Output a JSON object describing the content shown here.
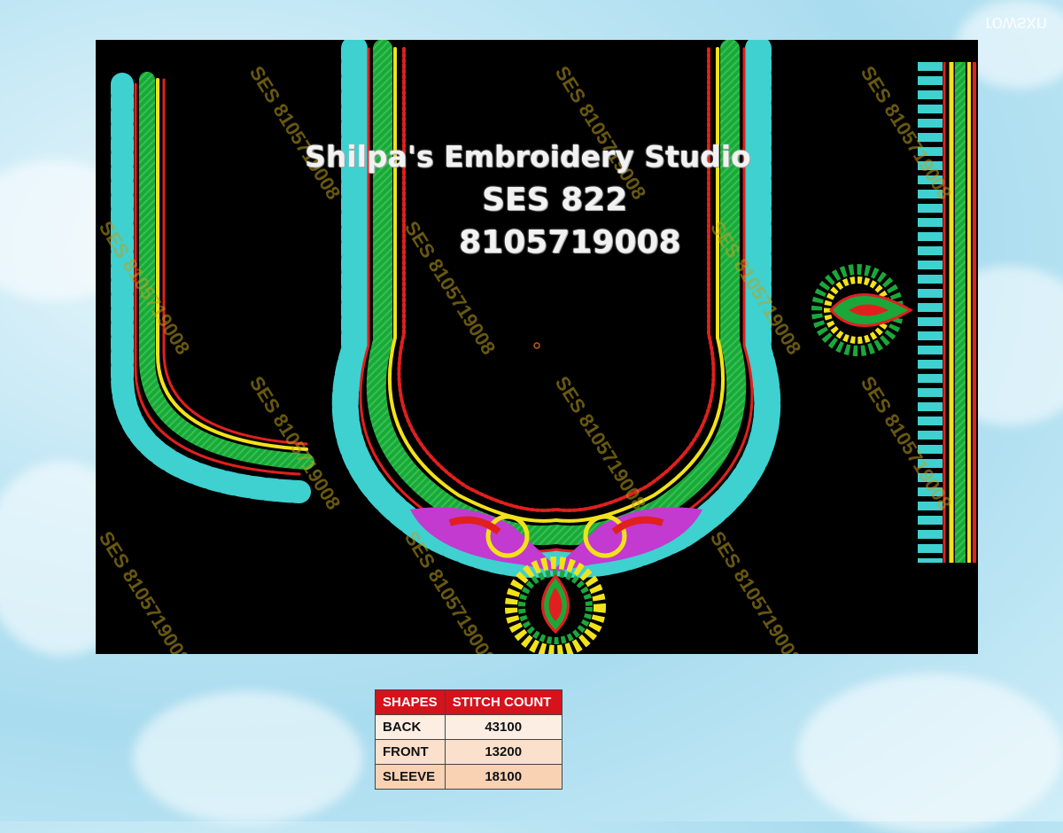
{
  "corner_text": "rowsxn",
  "design": {
    "studio_name": "Shilpa's Embroidery  Studio",
    "design_code": "SES  822",
    "phone": "8105719008",
    "watermark": "SES 8105719008"
  },
  "table": {
    "headers": [
      "SHAPES",
      "STITCH COUNT"
    ],
    "rows": [
      {
        "shape": "BACK",
        "count": "43100"
      },
      {
        "shape": "FRONT",
        "count": "13200"
      },
      {
        "shape": "SLEEVE",
        "count": "18100"
      }
    ]
  },
  "colors": {
    "background": "#000000",
    "turquoise": "#3fd0d0",
    "green": "#1aa83a",
    "yellow": "#f2e21a",
    "red": "#e0201e",
    "magenta": "#c23ad0",
    "header_red": "#d6121b"
  }
}
